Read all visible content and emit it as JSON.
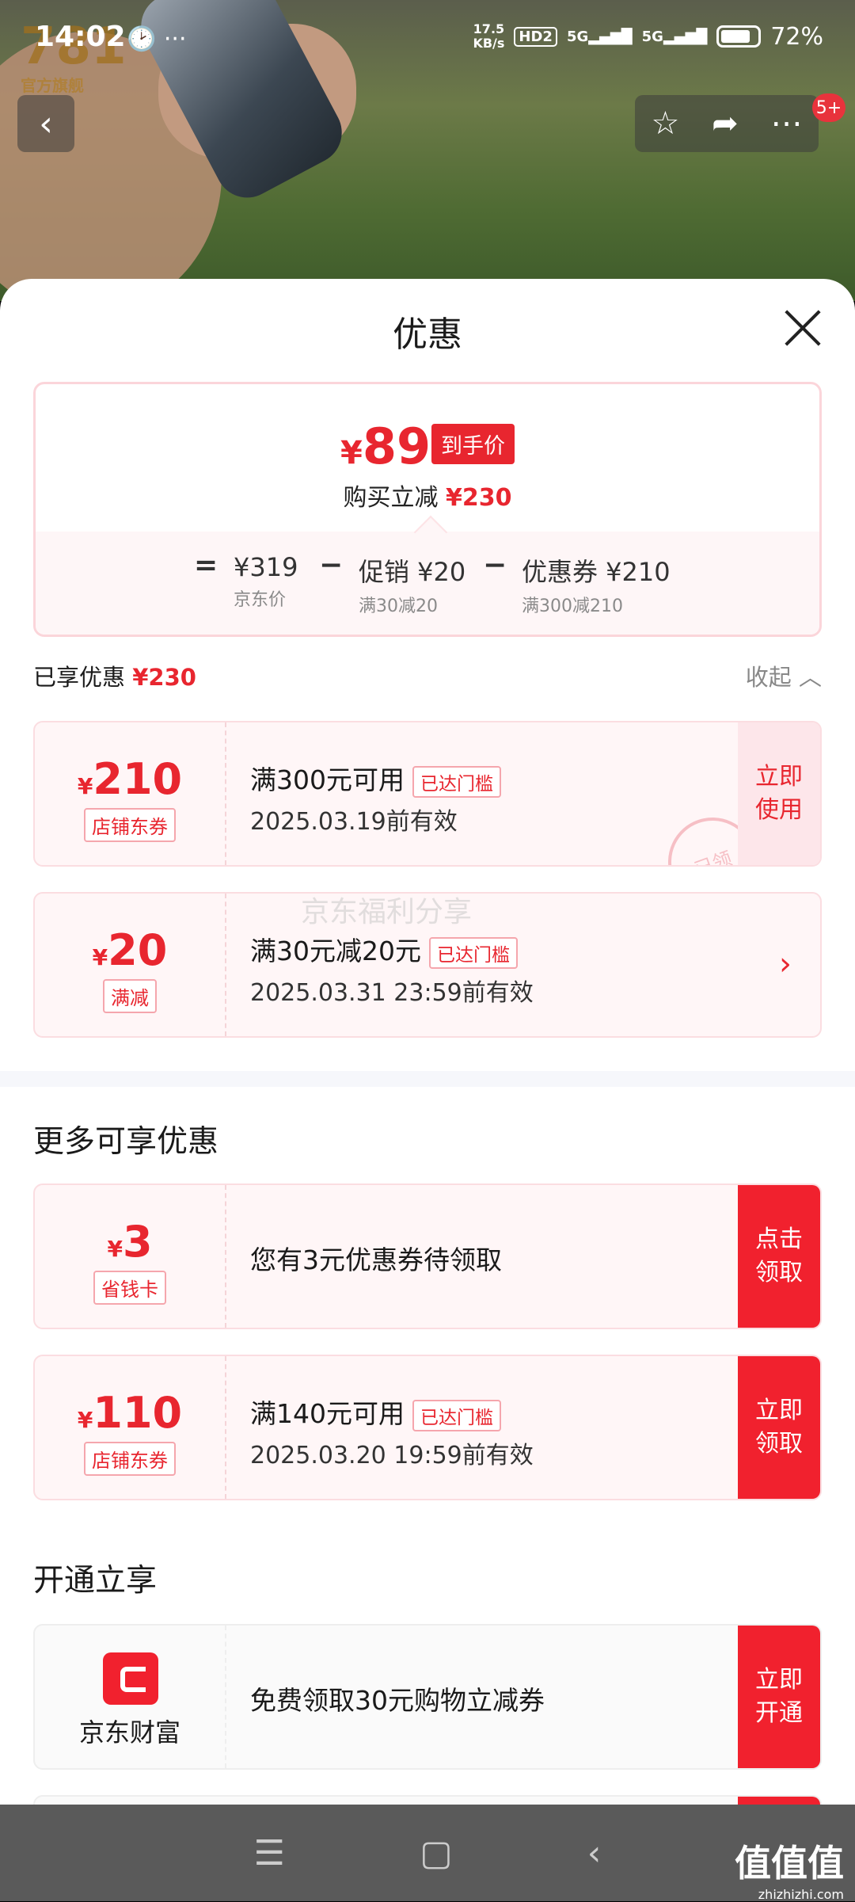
{
  "status_bar": {
    "time": "14:02",
    "speed_value": "17.5",
    "speed_unit": "KB/s",
    "hd_label": "HD2",
    "net1": "5G",
    "net2": "5G",
    "battery": "72%"
  },
  "header": {
    "badge_count": "5+"
  },
  "sheet": {
    "title": "优惠",
    "price_summary": {
      "final_price": "89",
      "final_price_tag": "到手价",
      "reduce_label": "购买立减",
      "reduce_amount": "¥230",
      "equals": "=",
      "minus": "−",
      "jd_price": "¥319",
      "jd_price_label": "京东价",
      "promo": "促销 ¥20",
      "promo_desc": "满30减20",
      "coupon": "优惠券 ¥210",
      "coupon_desc": "满300减210"
    },
    "enjoyed": {
      "label": "已享优惠",
      "amount": "¥230",
      "collapse_label": "收起"
    },
    "enjoyed_coupons": [
      {
        "amount": "210",
        "type": "店铺东券",
        "title": "满300元可用",
        "chip": "已达门槛",
        "date": "2025.03.19前有效",
        "action": "立即使用",
        "stamp": "已领"
      },
      {
        "amount": "20",
        "type": "满减",
        "title": "满30元减20元",
        "chip": "已达门槛",
        "date": "2025.03.31 23:59前有效"
      }
    ],
    "watermark": "京东福利分享",
    "more_title": "更多可享优惠",
    "more_coupons": [
      {
        "amount": "3",
        "type": "省钱卡",
        "title": "您有3元优惠券待领取",
        "action": "点击领取"
      },
      {
        "amount": "110",
        "type": "店铺东券",
        "title": "满140元可用",
        "chip": "已达门槛",
        "date": "2025.03.20 19:59前有效",
        "action": "立即领取"
      }
    ],
    "open_title": "开通立享",
    "open_items": [
      {
        "brand": "京东财富",
        "title": "免费领取30元购物立减券",
        "action": "立即开通"
      }
    ]
  },
  "corner_logo": {
    "text": "值值值",
    "url": "zhizhizhi.com"
  },
  "hero_logo": {
    "text": "官方旗舰"
  },
  "colors": {
    "accent": "#e8262f",
    "light_pink": "#fde6ea"
  }
}
